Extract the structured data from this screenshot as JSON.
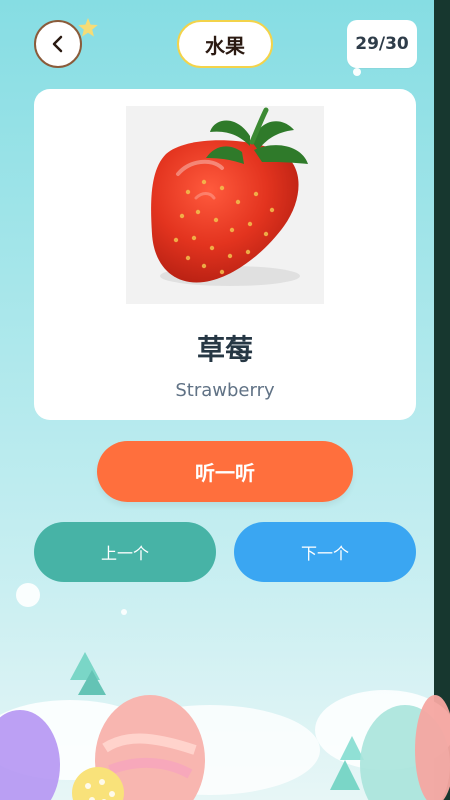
{
  "header": {
    "title": "水果",
    "counter": "29/30",
    "back_icon": "back-arrow-icon"
  },
  "card": {
    "image_subject": "strawberry",
    "name_zh": "草莓",
    "name_en": "Strawberry"
  },
  "actions": {
    "listen_label": "听一听",
    "prev_label": "上一个",
    "next_label": "下一个"
  },
  "colors": {
    "listen_button": "#ff6f3d",
    "prev_button": "#47b3a6",
    "next_button": "#3aa6f2",
    "title_border": "#f3d34a",
    "back_border": "#8a5b3a"
  }
}
